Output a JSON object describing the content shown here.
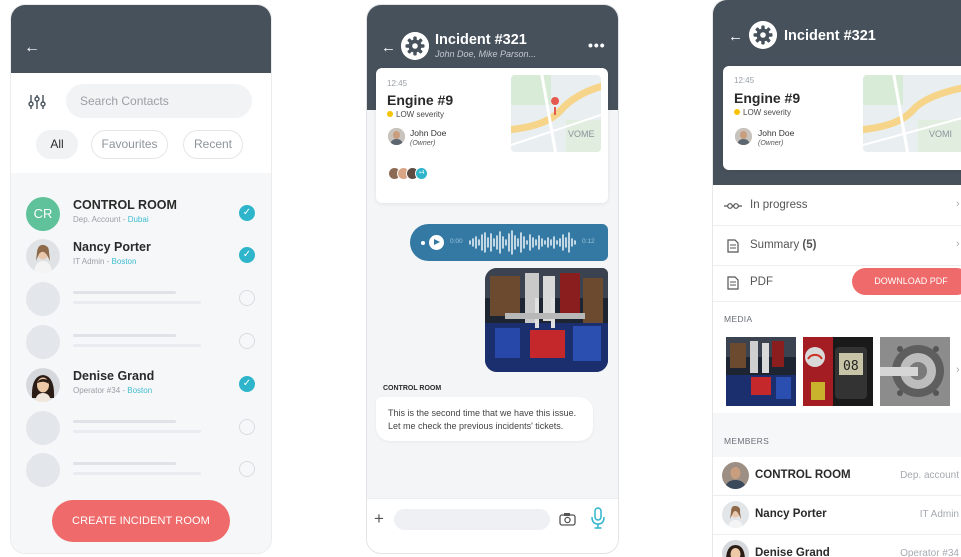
{
  "contacts_screen": {
    "back_icon": "arrow-left-icon",
    "filter_icon": "sliders-icon",
    "search_placeholder": "Search Contacts",
    "filters": [
      "All",
      "Favourites",
      "Recent"
    ],
    "active_filter": "All",
    "contacts": [
      {
        "initials": "CR",
        "name": "CONTROL ROOM",
        "role": "Dep. Account - ",
        "location": "Dubai",
        "checked": true
      },
      {
        "name": "Nancy Porter",
        "role": "IT Admin - ",
        "location": "Boston",
        "checked": true
      },
      {
        "name": "Denise Grand",
        "role": "Operator #34 - ",
        "location": "Boston",
        "checked": true
      }
    ],
    "create_button": "CREATE INCIDENT ROOM",
    "colors": {
      "header": "#47515c",
      "accent": "#2eb5cc",
      "primary_button": "#ef6b6b",
      "cr_avatar": "#5fc29a"
    }
  },
  "chat_screen": {
    "title": "Incident #321",
    "subtitle": "John Doe, Mike Parson...",
    "more_icon": "more-horizontal-icon",
    "incident_card": {
      "time": "12:45",
      "name": "Engine #9",
      "severity": "LOW severity",
      "owner_name": "John Doe",
      "owner_role": "(Owner)",
      "extra_members": "+4",
      "map_label": "VOME"
    },
    "audio": {
      "start": "0:00",
      "end": "0:12"
    },
    "message_sender": "CONTROL ROOM",
    "message_line1": "This is the second time that we have this issue.",
    "message_line2": "Let me check the previous incidents' tickets.",
    "composer_icons": [
      "plus-icon",
      "camera-icon",
      "microphone-icon"
    ]
  },
  "details_screen": {
    "title": "Incident #321",
    "incident_card": {
      "time": "12:45",
      "name": "Engine #9",
      "severity": "LOW severity",
      "owner_name": "John Doe",
      "owner_role": "(Owner)",
      "map_label": "VOMI"
    },
    "status": "In progress",
    "summary_label": "Summary",
    "summary_count": "(5)",
    "pdf_label": "PDF",
    "download_button": "DOWNLOAD PDF",
    "media_label": "MEDIA",
    "members_label": "MEMBERS",
    "members": [
      {
        "name": "CONTROL ROOM",
        "role": "Dep. account"
      },
      {
        "name": "Nancy Porter",
        "role": "IT Admin"
      },
      {
        "name": "Denise Grand",
        "role": "Operator #34"
      }
    ]
  }
}
